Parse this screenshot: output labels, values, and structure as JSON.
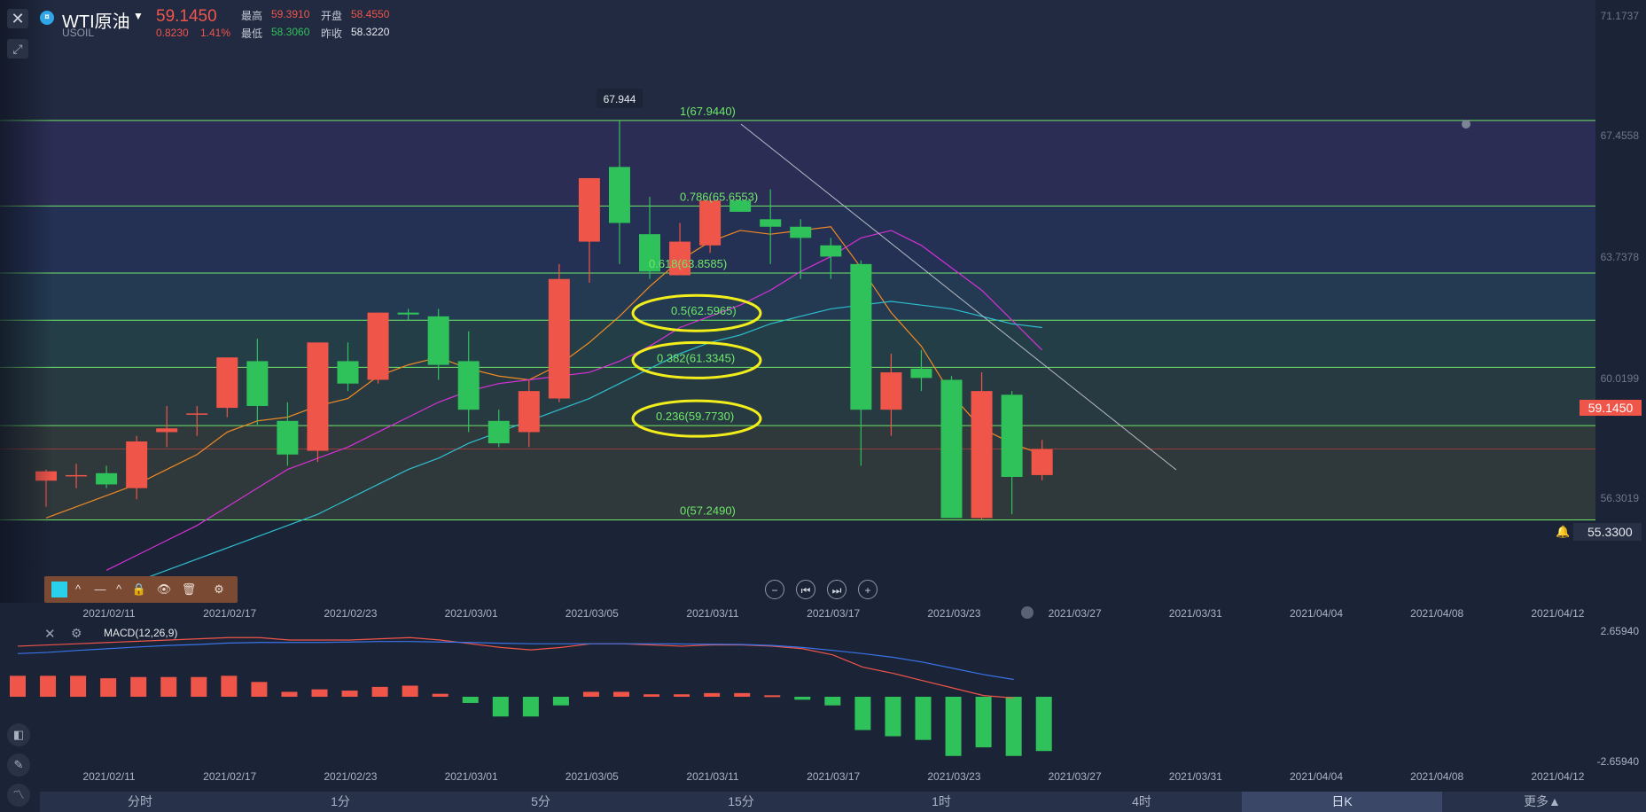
{
  "header": {
    "symbol_name": "WTI原油",
    "symbol_code": "USOIL",
    "last_price": "59.1450",
    "change": "0.8230",
    "change_pct": "1.41%",
    "high_label": "最高",
    "high_value": "59.3910",
    "open_label": "开盘",
    "open_value": "58.4550",
    "low_label": "最低",
    "low_value": "58.3060",
    "prev_close_label": "昨收",
    "prev_close_value": "58.3220"
  },
  "colors": {
    "up": "#f0554a",
    "down": "#2fc25b",
    "fib_line": "#6fe86a",
    "ellipse": "#f2ee1c",
    "ma_short": "#f08a24",
    "ma_mid": "#d631d6",
    "ma_long": "#2ebfd0",
    "macd_dif": "#f0554a",
    "macd_dea": "#3a74e8"
  },
  "chart_data": [
    {
      "type": "candlestick",
      "price_axis_labels": [
        "71.1737",
        "67.4558",
        "63.7378",
        "60.0199",
        "56.3019"
      ],
      "current_price_label": "59.1450",
      "alert_price_label": "55.3300",
      "peak_tooltip": "67.944",
      "date_labels": [
        "2021/02/11",
        "2021/02/17",
        "2021/02/23",
        "2021/03/01",
        "2021/03/05",
        "2021/03/11",
        "2021/03/17",
        "2021/03/23",
        "2021/03/27",
        "2021/03/31",
        "2021/04/04",
        "2021/04/08",
        "2021/04/12"
      ],
      "ylim": [
        55.03,
        71.17
      ],
      "candles": [
        {
          "o": 58.3,
          "h": 58.6,
          "l": 57.6,
          "c": 58.55
        },
        {
          "o": 58.45,
          "h": 58.75,
          "l": 58.1,
          "c": 58.45
        },
        {
          "o": 58.5,
          "h": 58.7,
          "l": 58.1,
          "c": 58.2
        },
        {
          "o": 58.1,
          "h": 59.5,
          "l": 57.8,
          "c": 59.35
        },
        {
          "o": 59.6,
          "h": 60.3,
          "l": 59.2,
          "c": 59.7
        },
        {
          "o": 60.1,
          "h": 60.3,
          "l": 59.5,
          "c": 60.1
        },
        {
          "o": 60.25,
          "h": 61.6,
          "l": 60.0,
          "c": 61.6
        },
        {
          "o": 61.5,
          "h": 62.1,
          "l": 59.8,
          "c": 60.3
        },
        {
          "o": 59.9,
          "h": 60.4,
          "l": 58.7,
          "c": 59.0
        },
        {
          "o": 59.1,
          "h": 62.0,
          "l": 58.8,
          "c": 62.0
        },
        {
          "o": 61.5,
          "h": 62.0,
          "l": 60.7,
          "c": 60.9
        },
        {
          "o": 61.0,
          "h": 62.8,
          "l": 60.9,
          "c": 62.8
        },
        {
          "o": 62.8,
          "h": 62.9,
          "l": 62.6,
          "c": 62.75
        },
        {
          "o": 62.7,
          "h": 62.9,
          "l": 61.0,
          "c": 61.4
        },
        {
          "o": 61.5,
          "h": 62.3,
          "l": 59.6,
          "c": 60.2
        },
        {
          "o": 59.9,
          "h": 60.2,
          "l": 59.2,
          "c": 59.3
        },
        {
          "o": 59.6,
          "h": 61.0,
          "l": 59.2,
          "c": 60.7
        },
        {
          "o": 60.5,
          "h": 64.1,
          "l": 60.4,
          "c": 63.7
        },
        {
          "o": 64.7,
          "h": 66.4,
          "l": 63.6,
          "c": 66.4
        },
        {
          "o": 66.7,
          "h": 67.94,
          "l": 64.1,
          "c": 65.2
        },
        {
          "o": 64.9,
          "h": 65.9,
          "l": 63.7,
          "c": 63.9
        },
        {
          "o": 63.8,
          "h": 65.2,
          "l": 63.8,
          "c": 64.7
        },
        {
          "o": 64.6,
          "h": 65.9,
          "l": 64.4,
          "c": 65.8
        },
        {
          "o": 65.8,
          "h": 65.9,
          "l": 65.5,
          "c": 65.5
        },
        {
          "o": 65.3,
          "h": 66.1,
          "l": 64.1,
          "c": 65.1
        },
        {
          "o": 65.1,
          "h": 65.3,
          "l": 63.7,
          "c": 64.8
        },
        {
          "o": 64.6,
          "h": 64.8,
          "l": 63.7,
          "c": 64.3
        },
        {
          "o": 64.1,
          "h": 64.2,
          "l": 58.7,
          "c": 60.2
        },
        {
          "o": 60.2,
          "h": 61.7,
          "l": 59.5,
          "c": 61.2
        },
        {
          "o": 61.3,
          "h": 61.8,
          "l": 60.7,
          "c": 61.05
        },
        {
          "o": 61.0,
          "h": 61.1,
          "l": 57.3,
          "c": 57.3
        },
        {
          "o": 57.3,
          "h": 61.2,
          "l": 57.25,
          "c": 60.7
        },
        {
          "o": 60.6,
          "h": 60.7,
          "l": 57.4,
          "c": 58.4
        },
        {
          "o": 58.45,
          "h": 59.39,
          "l": 58.31,
          "c": 59.145
        }
      ],
      "ma_short": [
        57.3,
        57.6,
        57.9,
        58.2,
        58.6,
        59.0,
        59.6,
        59.9,
        60.0,
        60.3,
        60.5,
        61.1,
        61.4,
        61.6,
        61.3,
        61.1,
        61.0,
        61.4,
        62.0,
        62.7,
        63.5,
        64.2,
        64.7,
        65.0,
        64.9,
        65.0,
        65.1,
        64.0,
        62.8,
        61.9,
        60.6,
        59.7,
        59.3,
        59.0
      ],
      "ma_mid": [
        55.9,
        56.3,
        56.7,
        57.1,
        57.6,
        58.1,
        58.6,
        58.9,
        59.2,
        59.6,
        60.0,
        60.4,
        60.7,
        60.9,
        61.0,
        61.1,
        61.2,
        61.5,
        61.9,
        62.4,
        62.7,
        63.0,
        63.4,
        63.9,
        64.3,
        64.8,
        65.0,
        64.6,
        64.0,
        63.4,
        62.6,
        61.8
      ],
      "ma_long": [
        55.3,
        55.6,
        55.9,
        56.2,
        56.5,
        56.8,
        57.1,
        57.4,
        57.8,
        58.2,
        58.6,
        58.9,
        59.3,
        59.6,
        59.9,
        60.2,
        60.5,
        60.9,
        61.3,
        61.7,
        62.0,
        62.2,
        62.5,
        62.7,
        62.9,
        63.0,
        63.1,
        63.0,
        62.9,
        62.7,
        62.5,
        62.4
      ],
      "fibonacci": [
        {
          "label": "1(67.9440)",
          "value": 67.944
        },
        {
          "label": "0.786(65.6553)",
          "value": 65.6553
        },
        {
          "label": "0.618(63.8585)",
          "value": 63.8585
        },
        {
          "label": "0.5(62.5965)",
          "value": 62.5965
        },
        {
          "label": "0.382(61.3345)",
          "value": 61.3345
        },
        {
          "label": "0.236(59.7730)",
          "value": 59.773
        },
        {
          "label": "0(57.2490)",
          "value": 57.249
        }
      ],
      "highlighted_levels": [
        "0.5(62.5965)",
        "0.382(61.3345)",
        "0.236(59.7730)"
      ]
    },
    {
      "type": "bar",
      "title": "MACD(12,26,9)",
      "axis_labels": [
        "2.65940",
        "-2.65940"
      ],
      "ylim": [
        -2.6594,
        2.6594
      ],
      "histogram": [
        0.85,
        0.85,
        0.85,
        0.75,
        0.8,
        0.8,
        0.8,
        0.85,
        0.6,
        0.2,
        0.3,
        0.25,
        0.4,
        0.45,
        0.12,
        -0.25,
        -0.8,
        -0.8,
        -0.35,
        0.2,
        0.2,
        0.1,
        0.1,
        0.15,
        0.15,
        0.06,
        -0.12,
        -0.35,
        -1.35,
        -1.6,
        -1.75,
        -2.4,
        -2.05,
        -2.4,
        -2.2
      ],
      "dif": [
        2.05,
        2.1,
        2.15,
        2.2,
        2.25,
        2.3,
        2.35,
        2.4,
        2.4,
        2.3,
        2.3,
        2.3,
        2.35,
        2.4,
        2.3,
        2.15,
        2.0,
        1.9,
        2.0,
        2.15,
        2.15,
        2.1,
        2.05,
        2.1,
        2.1,
        2.05,
        1.95,
        1.7,
        1.2,
        0.95,
        0.65,
        0.35,
        0.05,
        -0.05
      ],
      "dea": [
        1.75,
        1.8,
        1.88,
        1.95,
        2.02,
        2.08,
        2.12,
        2.18,
        2.2,
        2.2,
        2.2,
        2.22,
        2.24,
        2.24,
        2.22,
        2.2,
        2.17,
        2.15,
        2.15,
        2.15,
        2.15,
        2.15,
        2.14,
        2.13,
        2.12,
        2.08,
        2.0,
        1.88,
        1.75,
        1.6,
        1.4,
        1.15,
        0.9,
        0.7
      ]
    }
  ],
  "toolbar": {
    "items": [
      "^",
      "—",
      "^"
    ]
  },
  "bottom_bar": {
    "items": [
      "分时",
      "1分",
      "5分",
      "15分",
      "1时",
      "4时",
      "日K"
    ],
    "active": "日K",
    "more": "更多▲"
  }
}
